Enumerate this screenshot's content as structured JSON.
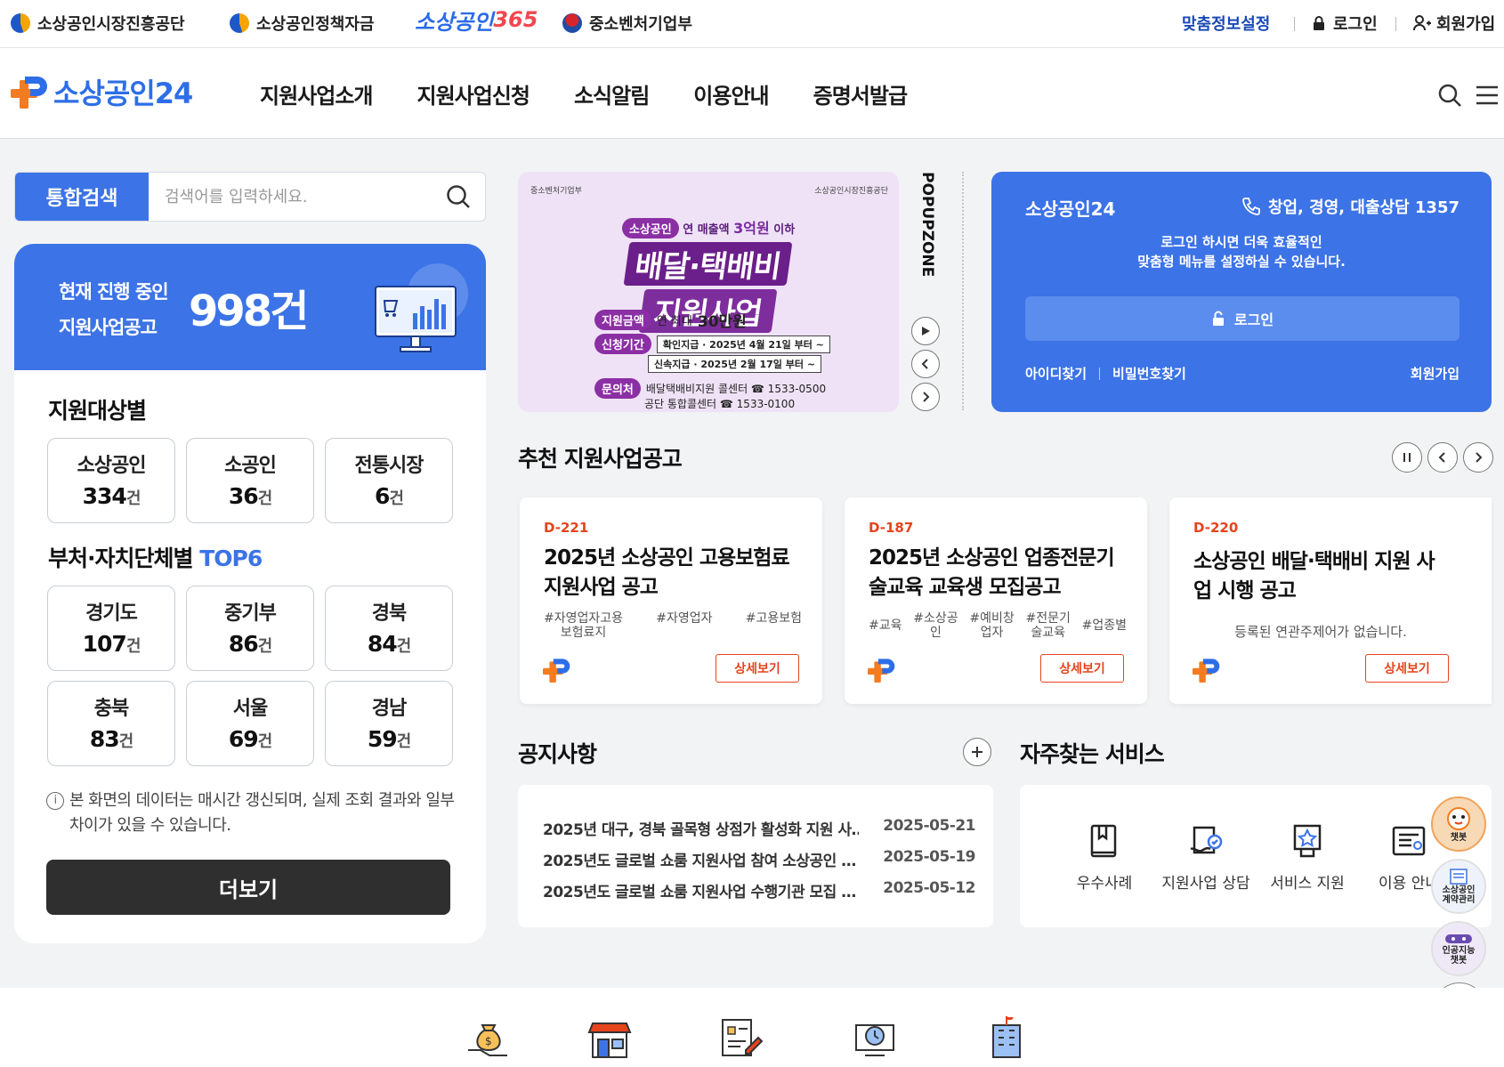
{
  "util": {
    "org_semas": "소상공인시장진흥공단",
    "org_fund": "소상공인정책자금",
    "org_365_prefix": "소상공인",
    "org_365_suffix": "365",
    "org_mss": "중소벤처기업부",
    "custom_info": "맞춤정보설정",
    "login": "로그인",
    "join": "회원가입"
  },
  "header": {
    "brand": "소상공인24",
    "menu": [
      "지원사업소개",
      "지원사업신청",
      "소식알림",
      "이용안내",
      "증명서발급"
    ]
  },
  "search": {
    "tab_label": "통합검색",
    "placeholder": "검색어를 입력하세요."
  },
  "summary": {
    "label_line1": "현재 진행 중인",
    "label_line2": "지원사업공고",
    "count": "998건"
  },
  "by_target": {
    "title": "지원대상별",
    "items": [
      {
        "label": "소상공인",
        "value": "334",
        "unit": "건"
      },
      {
        "label": "소공인",
        "value": "36",
        "unit": "건"
      },
      {
        "label": "전통시장",
        "value": "6",
        "unit": "건"
      }
    ]
  },
  "by_region": {
    "title": "부처·자치단체별",
    "title_accent": "TOP6",
    "items": [
      {
        "label": "경기도",
        "value": "107",
        "unit": "건"
      },
      {
        "label": "중기부",
        "value": "86",
        "unit": "건"
      },
      {
        "label": "경북",
        "value": "84",
        "unit": "건"
      },
      {
        "label": "충북",
        "value": "83",
        "unit": "건"
      },
      {
        "label": "서울",
        "value": "69",
        "unit": "건"
      },
      {
        "label": "경남",
        "value": "59",
        "unit": "건"
      }
    ]
  },
  "data_notice": "본 화면의 데이터는 매시간 갱신되며, 실제 조회 결과와 일부 차이가 있을 수 있습니다.",
  "more_button": "더보기",
  "popup": {
    "zone_label": "POPUPZONE",
    "org_left": "중소벤처기업부",
    "org_right": "소상공인시장진흥공단",
    "badge": "소상공인",
    "condition_prefix": "연 매출액",
    "condition_amount": "3억원",
    "condition_suffix": "이하",
    "headline1": "배달·택배비",
    "headline2": "지원사업",
    "amount_label": "지원금액",
    "amount_prefix": "연 최대",
    "amount_value": "30만원",
    "period_label": "신청기간",
    "period_rows": [
      {
        "type": "확인지급",
        "date": "2025년 4월 21일 부터 ~"
      },
      {
        "type": "신속지급",
        "date": "2025년 2월 17일 부터 ~"
      }
    ],
    "contact_label": "문의처",
    "contact1": "배달택배비지원 콜센터 ☎ 1533-0500",
    "contact2": "공단 통합콜센터 ☎ 1533-0100"
  },
  "login_card": {
    "brand": "소상공인24",
    "phone": "창업, 경영, 대출상담 1357",
    "message_line1": "로그인 하시면 더욱 효율적인",
    "message_line2": "맞춤형 메뉴를 설정하실 수 있습니다.",
    "login_button": "로그인",
    "find_id": "아이디찾기",
    "find_pw": "비밀번호찾기",
    "join": "회원가입"
  },
  "recommend": {
    "title": "추천 지원사업공고",
    "cards": [
      {
        "dday": "D-221",
        "title": "2025년 소상공인 고용보험료 지원사업 공고",
        "tags": [
          "#자영업자고용\n보험료지",
          "#자영업자",
          "#고용보험"
        ],
        "empty": "",
        "button": "상세보기"
      },
      {
        "dday": "D-187",
        "title": "2025년 소상공인 업종전문기술교육 교육생 모집공고",
        "tags": [
          "#교육",
          "#소상공\n인",
          "#예비창\n업자",
          "#전문기\n술교육",
          "#업종별"
        ],
        "empty": "",
        "button": "상세보기"
      },
      {
        "dday": "D-220",
        "title": "소상공인 배달·택배비 지원 사업 시행 공고",
        "tags": [],
        "empty": "등록된 연관주제어가 없습니다.",
        "button": "상세보기"
      }
    ]
  },
  "notices": {
    "title": "공지사항",
    "items": [
      {
        "title": "2025년 대구, 경북 골목형 상점가 활성화 지원 사…",
        "date": "2025-05-21"
      },
      {
        "title": "2025년도 글로벌 쇼룸 지원사업 참여 소상공인 …",
        "date": "2025-05-19"
      },
      {
        "title": "2025년도 글로벌 쇼룸 지원사업 수행기관 모집 …",
        "date": "2025-05-12"
      }
    ]
  },
  "services": {
    "title": "자주찾는 서비스",
    "items": [
      {
        "label": "우수사례",
        "icon": "book-icon"
      },
      {
        "label": "지원사업 상담",
        "icon": "consult-icon"
      },
      {
        "label": "서비스 지원",
        "icon": "award-icon"
      },
      {
        "label": "이용 안내",
        "icon": "guide-icon"
      }
    ]
  },
  "floating": {
    "chatbot": "챗봇",
    "contract": "소상공인\n계약관리",
    "ai_chatbot": "인공지능\n챗봇"
  },
  "colors": {
    "primary": "#3c73e6",
    "accent_orange": "#e5441d",
    "dark_button": "#2f2f2f"
  }
}
